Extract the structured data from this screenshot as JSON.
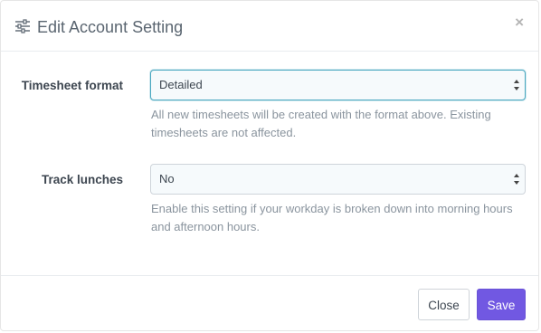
{
  "modal": {
    "title": "Edit Account Setting",
    "close_glyph": "×",
    "header_icon": "sliders-icon"
  },
  "fields": [
    {
      "label": "Timesheet format",
      "value": "Detailed",
      "help": "All new timesheets will be created with the format above. Existing timesheets are not affected."
    },
    {
      "label": "Track lunches",
      "value": "No",
      "help": "Enable this setting if your workday is broken down into morning hours and afternoon hours."
    }
  ],
  "footer": {
    "close_label": "Close",
    "save_label": "Save"
  },
  "colors": {
    "accent": "#7158e2",
    "focus": "#4aa8c0"
  }
}
